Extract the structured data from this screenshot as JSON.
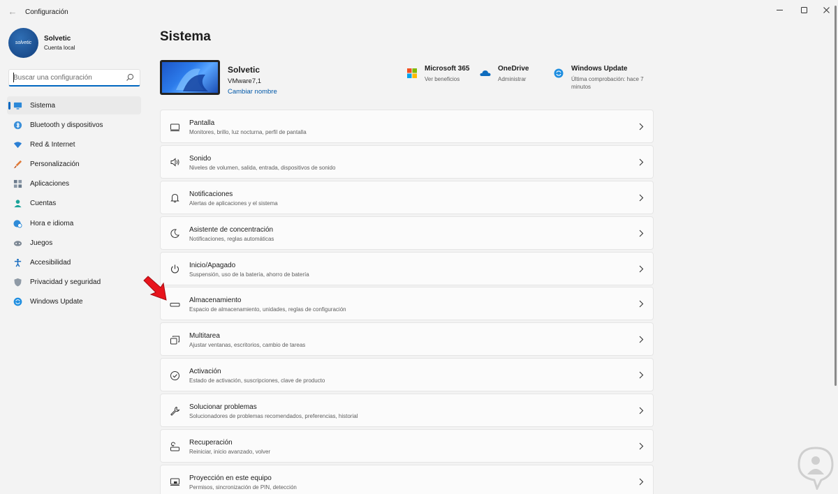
{
  "window": {
    "title": "Configuración"
  },
  "profile": {
    "name": "Solvetic",
    "account": "Cuenta local",
    "avatar_text": "solvetic"
  },
  "search": {
    "placeholder": "Buscar una configuración"
  },
  "sidebar": {
    "items": [
      {
        "label": "Sistema",
        "icon": "system-icon",
        "active": true
      },
      {
        "label": "Bluetooth y dispositivos",
        "icon": "bluetooth-icon"
      },
      {
        "label": "Red & Internet",
        "icon": "wifi-icon"
      },
      {
        "label": "Personalización",
        "icon": "brush-icon"
      },
      {
        "label": "Aplicaciones",
        "icon": "apps-icon"
      },
      {
        "label": "Cuentas",
        "icon": "person-icon"
      },
      {
        "label": "Hora e idioma",
        "icon": "globe-clock-icon"
      },
      {
        "label": "Juegos",
        "icon": "gamepad-icon"
      },
      {
        "label": "Accesibilidad",
        "icon": "accessibility-icon"
      },
      {
        "label": "Privacidad y seguridad",
        "icon": "shield-icon"
      },
      {
        "label": "Windows Update",
        "icon": "update-icon"
      }
    ]
  },
  "main": {
    "title": "Sistema",
    "device": {
      "name": "Solvetic",
      "model": "VMware7,1",
      "rename_label": "Cambiar nombre"
    },
    "quick": [
      {
        "title": "Microsoft 365",
        "sub": "Ver beneficios",
        "icon": "microsoft-logo-icon"
      },
      {
        "title": "OneDrive",
        "sub": "Administrar",
        "icon": "onedrive-cloud-icon"
      },
      {
        "title": "Windows Update",
        "sub": "Última comprobación: hace 7 minutos",
        "icon": "update-icon"
      }
    ],
    "cards": [
      {
        "title": "Pantalla",
        "sub": "Monitores, brillo, luz nocturna, perfil de pantalla",
        "icon": "display-icon"
      },
      {
        "title": "Sonido",
        "sub": "Niveles de volumen, salida, entrada, dispositivos de sonido",
        "icon": "speaker-icon"
      },
      {
        "title": "Notificaciones",
        "sub": "Alertas de aplicaciones y el sistema",
        "icon": "bell-icon"
      },
      {
        "title": "Asistente de concentración",
        "sub": "Notificaciones, reglas automáticas",
        "icon": "moon-icon"
      },
      {
        "title": "Inicio/Apagado",
        "sub": "Suspensión, uso de la batería, ahorro de batería",
        "icon": "power-icon"
      },
      {
        "title": "Almacenamiento",
        "sub": "Espacio de almacenamiento, unidades, reglas de configuración",
        "icon": "storage-icon"
      },
      {
        "title": "Multitarea",
        "sub": "Ajustar ventanas, escritorios, cambio de tareas",
        "icon": "multitask-icon"
      },
      {
        "title": "Activación",
        "sub": "Estado de activación, suscripciones, clave de producto",
        "icon": "check-circle-icon"
      },
      {
        "title": "Solucionar problemas",
        "sub": "Solucionadores de problemas recomendados, preferencias, historial",
        "icon": "wrench-icon"
      },
      {
        "title": "Recuperación",
        "sub": "Reiniciar, inicio avanzado, volver",
        "icon": "recovery-icon"
      },
      {
        "title": "Proyección en este equipo",
        "sub": "Permisos, sincronización de PIN, detección",
        "icon": "projection-icon"
      }
    ]
  },
  "colors": {
    "accent": "#0067c0",
    "background": "#f3f3f3",
    "card": "#fbfbfb",
    "annotation_arrow": "#e8141c"
  }
}
